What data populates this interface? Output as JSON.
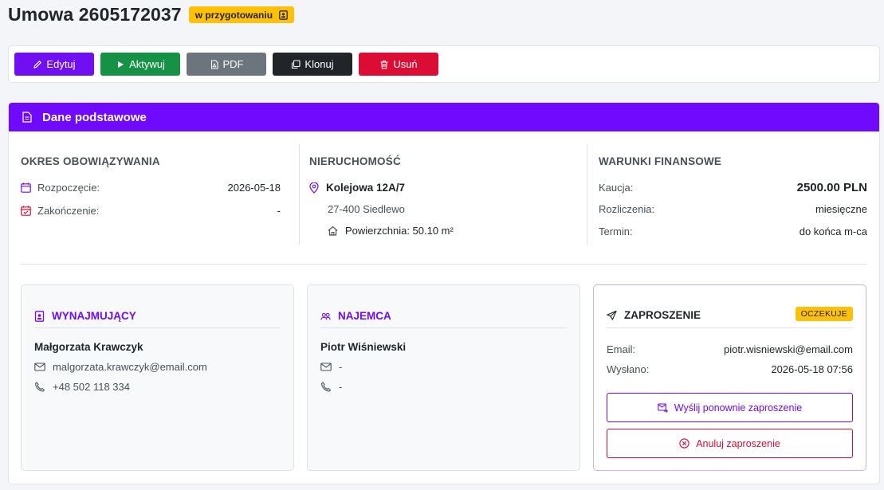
{
  "header": {
    "title": "Umowa 2605172037",
    "status_badge": "w przygotowaniu"
  },
  "toolbar": {
    "edit_label": "Edytuj",
    "activate_label": "Aktywuj",
    "pdf_label": "PDF",
    "clone_label": "Klonuj",
    "delete_label": "Usuń"
  },
  "card": {
    "title": "Dane podstawowe"
  },
  "period": {
    "title": "OKRES OBOWIĄZYWANIA",
    "start_label": "Rozpoczęcie:",
    "start_value": "2026-05-18",
    "end_label": "Zakończenie:",
    "end_value": "-"
  },
  "property": {
    "title": "NIERUCHOMOŚĆ",
    "address": "Kolejowa 12A/7",
    "city": "27-400 Siedlewo",
    "area": "Powierzchnia: 50.10 m²"
  },
  "finance": {
    "title": "WARUNKI FINANSOWE",
    "deposit_label": "Kaucja:",
    "deposit_value": "2500.00 PLN",
    "settlement_label": "Rozliczenia:",
    "settlement_value": "miesięczne",
    "term_label": "Termin:",
    "term_value": "do końca m-ca"
  },
  "landlord": {
    "title": "WYNAJMUJĄCY",
    "name": "Małgorzata Krawczyk",
    "email": "malgorzata.krawczyk@email.com",
    "phone": "+48 502 118 334"
  },
  "tenant": {
    "title": "NAJEMCA",
    "name": "Piotr Wiśniewski",
    "email": "-",
    "phone": "-"
  },
  "invitation": {
    "title": "ZAPROSZENIE",
    "status": "OCZEKUJE",
    "email_label": "Email:",
    "email_value": "piotr.wisniewski@email.com",
    "sent_label": "Wysłano:",
    "sent_value": "2026-05-18 07:56",
    "resend_label": "Wyślij ponownie zaproszenie",
    "cancel_label": "Anuluj zaproszenie"
  },
  "colors": {
    "primary": "#6f0aff",
    "success": "#159246",
    "secondary": "#6c757d",
    "dark": "#212529",
    "danger": "#dc0d34",
    "warning": "#ffc107"
  },
  "icons": {
    "status": "contract-person-icon",
    "edit": "pencil-icon",
    "activate": "play-icon",
    "pdf": "pdf-file-icon",
    "clone": "copy-icon",
    "delete": "trash-icon",
    "card": "document-icon",
    "start": "calendar-icon",
    "end": "calendar-check-icon",
    "location": "map-pin-icon",
    "area": "house-icon",
    "landlord": "person-badge-icon",
    "tenant": "people-icon",
    "invitation": "send-icon",
    "email": "envelope-icon",
    "phone": "phone-icon",
    "resend": "envelope-arrow-icon",
    "cancel": "x-circle-icon"
  }
}
